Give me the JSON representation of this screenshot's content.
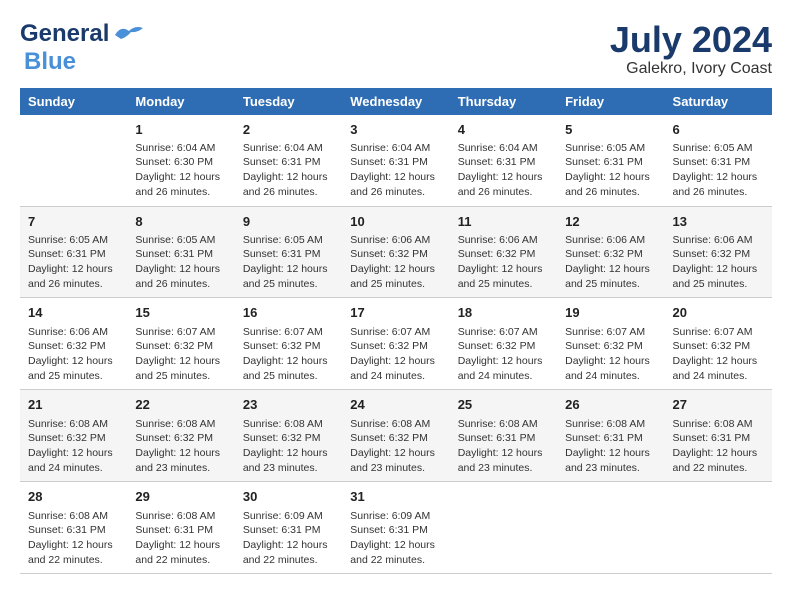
{
  "header": {
    "logo_line1": "General",
    "logo_line2": "Blue",
    "month_year": "July 2024",
    "location": "Galekro, Ivory Coast"
  },
  "days_of_week": [
    "Sunday",
    "Monday",
    "Tuesday",
    "Wednesday",
    "Thursday",
    "Friday",
    "Saturday"
  ],
  "weeks": [
    [
      {
        "day": "",
        "info": ""
      },
      {
        "day": "1",
        "info": "Sunrise: 6:04 AM\nSunset: 6:30 PM\nDaylight: 12 hours\nand 26 minutes."
      },
      {
        "day": "2",
        "info": "Sunrise: 6:04 AM\nSunset: 6:31 PM\nDaylight: 12 hours\nand 26 minutes."
      },
      {
        "day": "3",
        "info": "Sunrise: 6:04 AM\nSunset: 6:31 PM\nDaylight: 12 hours\nand 26 minutes."
      },
      {
        "day": "4",
        "info": "Sunrise: 6:04 AM\nSunset: 6:31 PM\nDaylight: 12 hours\nand 26 minutes."
      },
      {
        "day": "5",
        "info": "Sunrise: 6:05 AM\nSunset: 6:31 PM\nDaylight: 12 hours\nand 26 minutes."
      },
      {
        "day": "6",
        "info": "Sunrise: 6:05 AM\nSunset: 6:31 PM\nDaylight: 12 hours\nand 26 minutes."
      }
    ],
    [
      {
        "day": "7",
        "info": "Sunrise: 6:05 AM\nSunset: 6:31 PM\nDaylight: 12 hours\nand 26 minutes."
      },
      {
        "day": "8",
        "info": "Sunrise: 6:05 AM\nSunset: 6:31 PM\nDaylight: 12 hours\nand 26 minutes."
      },
      {
        "day": "9",
        "info": "Sunrise: 6:05 AM\nSunset: 6:31 PM\nDaylight: 12 hours\nand 25 minutes."
      },
      {
        "day": "10",
        "info": "Sunrise: 6:06 AM\nSunset: 6:32 PM\nDaylight: 12 hours\nand 25 minutes."
      },
      {
        "day": "11",
        "info": "Sunrise: 6:06 AM\nSunset: 6:32 PM\nDaylight: 12 hours\nand 25 minutes."
      },
      {
        "day": "12",
        "info": "Sunrise: 6:06 AM\nSunset: 6:32 PM\nDaylight: 12 hours\nand 25 minutes."
      },
      {
        "day": "13",
        "info": "Sunrise: 6:06 AM\nSunset: 6:32 PM\nDaylight: 12 hours\nand 25 minutes."
      }
    ],
    [
      {
        "day": "14",
        "info": "Sunrise: 6:06 AM\nSunset: 6:32 PM\nDaylight: 12 hours\nand 25 minutes."
      },
      {
        "day": "15",
        "info": "Sunrise: 6:07 AM\nSunset: 6:32 PM\nDaylight: 12 hours\nand 25 minutes."
      },
      {
        "day": "16",
        "info": "Sunrise: 6:07 AM\nSunset: 6:32 PM\nDaylight: 12 hours\nand 25 minutes."
      },
      {
        "day": "17",
        "info": "Sunrise: 6:07 AM\nSunset: 6:32 PM\nDaylight: 12 hours\nand 24 minutes."
      },
      {
        "day": "18",
        "info": "Sunrise: 6:07 AM\nSunset: 6:32 PM\nDaylight: 12 hours\nand 24 minutes."
      },
      {
        "day": "19",
        "info": "Sunrise: 6:07 AM\nSunset: 6:32 PM\nDaylight: 12 hours\nand 24 minutes."
      },
      {
        "day": "20",
        "info": "Sunrise: 6:07 AM\nSunset: 6:32 PM\nDaylight: 12 hours\nand 24 minutes."
      }
    ],
    [
      {
        "day": "21",
        "info": "Sunrise: 6:08 AM\nSunset: 6:32 PM\nDaylight: 12 hours\nand 24 minutes."
      },
      {
        "day": "22",
        "info": "Sunrise: 6:08 AM\nSunset: 6:32 PM\nDaylight: 12 hours\nand 23 minutes."
      },
      {
        "day": "23",
        "info": "Sunrise: 6:08 AM\nSunset: 6:32 PM\nDaylight: 12 hours\nand 23 minutes."
      },
      {
        "day": "24",
        "info": "Sunrise: 6:08 AM\nSunset: 6:32 PM\nDaylight: 12 hours\nand 23 minutes."
      },
      {
        "day": "25",
        "info": "Sunrise: 6:08 AM\nSunset: 6:31 PM\nDaylight: 12 hours\nand 23 minutes."
      },
      {
        "day": "26",
        "info": "Sunrise: 6:08 AM\nSunset: 6:31 PM\nDaylight: 12 hours\nand 23 minutes."
      },
      {
        "day": "27",
        "info": "Sunrise: 6:08 AM\nSunset: 6:31 PM\nDaylight: 12 hours\nand 22 minutes."
      }
    ],
    [
      {
        "day": "28",
        "info": "Sunrise: 6:08 AM\nSunset: 6:31 PM\nDaylight: 12 hours\nand 22 minutes."
      },
      {
        "day": "29",
        "info": "Sunrise: 6:08 AM\nSunset: 6:31 PM\nDaylight: 12 hours\nand 22 minutes."
      },
      {
        "day": "30",
        "info": "Sunrise: 6:09 AM\nSunset: 6:31 PM\nDaylight: 12 hours\nand 22 minutes."
      },
      {
        "day": "31",
        "info": "Sunrise: 6:09 AM\nSunset: 6:31 PM\nDaylight: 12 hours\nand 22 minutes."
      },
      {
        "day": "",
        "info": ""
      },
      {
        "day": "",
        "info": ""
      },
      {
        "day": "",
        "info": ""
      }
    ]
  ]
}
